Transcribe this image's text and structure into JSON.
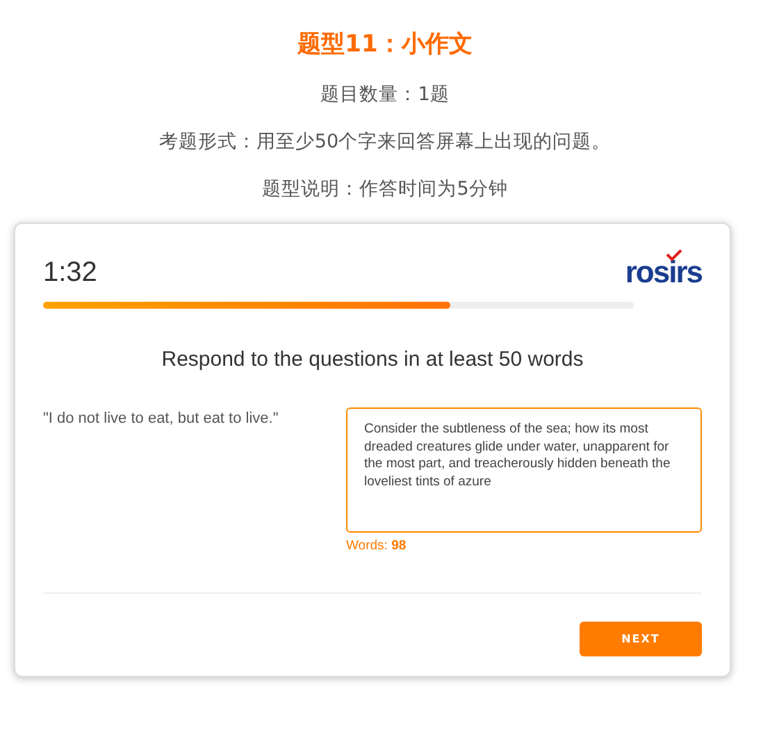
{
  "header": {
    "title": "题型11：小作文",
    "lines": [
      "题目数量：1题",
      "考题形式：用至少50个字来回答屏幕上出现的问题。",
      "题型说明：作答时间为5分钟"
    ]
  },
  "card": {
    "timer": "1:32",
    "logo": "rosirs",
    "progress": {
      "level": 0.69
    },
    "heading": "Respond to the questions in at least 50 words",
    "prompt": "\"I do not live to eat, but eat to live.\"",
    "answer": {
      "value": "Consider the subtleness of the sea; how its most dreaded creatures glide under water, unapparent for the most part, and treacherously hidden beneath the loveliest tints of azure",
      "focused": true
    },
    "word_count": "Words: **98**",
    "next_button": "NEXT"
  }
}
